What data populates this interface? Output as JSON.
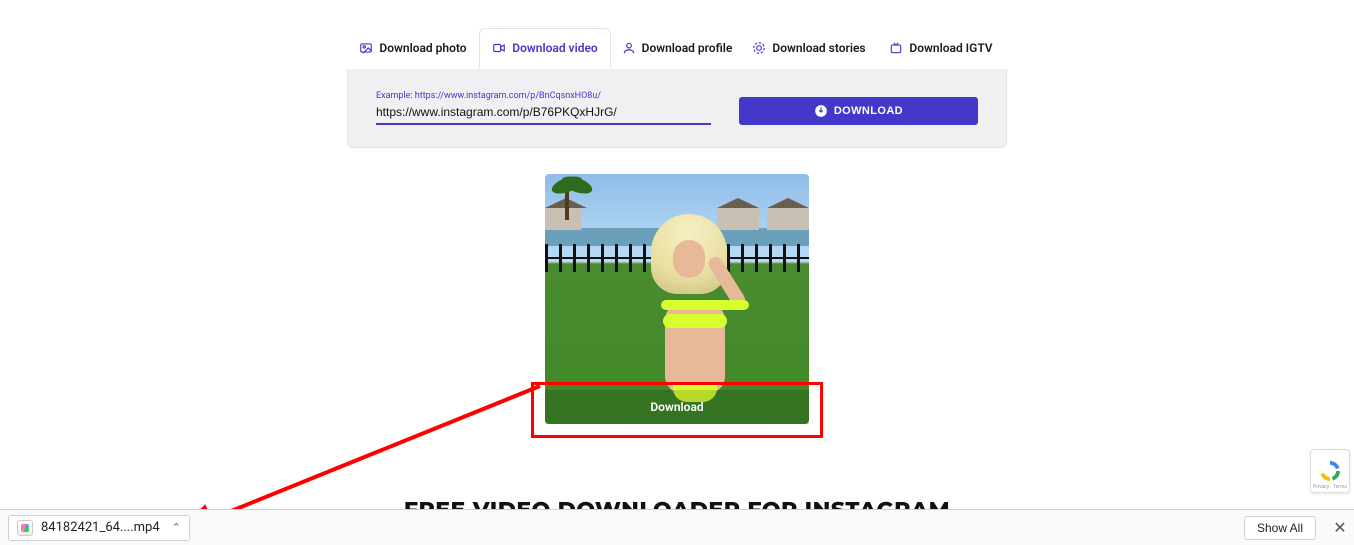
{
  "tabs": {
    "photo": "Download photo",
    "video": "Download video",
    "profile": "Download profile",
    "stories": "Download stories",
    "igtv": "Download IGTV"
  },
  "form": {
    "example": "Example: https://www.instagram.com/p/BnCqsnxHO8u/",
    "value": "https://www.instagram.com/p/B76PKQxHJrG/",
    "button": "DOWNLOAD"
  },
  "preview": {
    "overlay_label": "Download"
  },
  "title": "FREE VIDEO DOWNLOADER FOR INSTAGRAM",
  "download_bar": {
    "filename": "84182421_64....mp4",
    "show_all": "Show All"
  },
  "recaptcha_note": "Privacy - Terms"
}
